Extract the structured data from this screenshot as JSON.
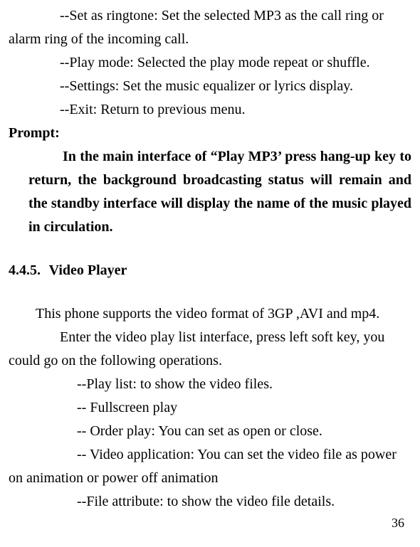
{
  "items": {
    "ringtone": "--Set as ringtone: Set the selected MP3 as the call ring or alarm ring of the incoming call.",
    "playmode": "--Play mode: Selected the play mode repeat or shuffle.",
    "settings": "--Settings: Set the music equalizer or lyrics display.",
    "exit": "--Exit: Return to previous menu."
  },
  "prompt": {
    "label": "Prompt:",
    "body": "In the main interface of “Play MP3’ press hang-up key to return, the background broadcasting status will remain and the standby interface will display the name of the music played in circulation."
  },
  "section": {
    "number": "4.4.5.",
    "title": "Video Player"
  },
  "video": {
    "intro": "This phone supports the video format of 3GP ,AVI and mp4.",
    "para": "Enter the video play list interface, press left soft key, you could go on the following operations.",
    "playlist": "--Play list: to show the video files.",
    "fullscreen": "-- Fullscreen play",
    "orderplay": "-- Order play: You can set as open or close.",
    "videoapp": "-- Video application: You can set the video file as power on animation or power off animation",
    "fileattr": "--File attribute: to show the video file details."
  },
  "page_number": "36"
}
